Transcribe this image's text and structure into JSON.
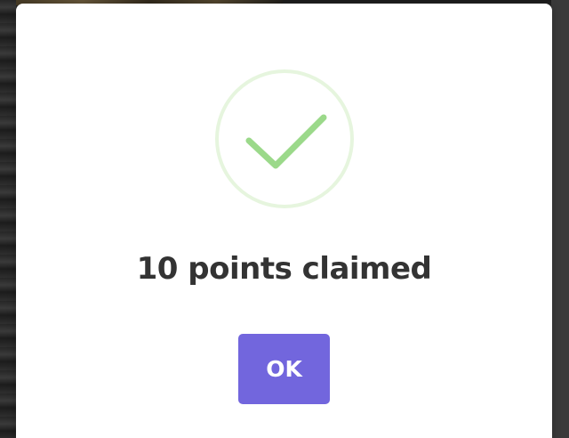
{
  "modal": {
    "icon": "checkmark-icon",
    "title": "10 points claimed",
    "ok_label": "OK"
  },
  "colors": {
    "accent": "#7266dd",
    "success": "#9bd98a",
    "success_ring": "#e6f5de",
    "text": "#333333"
  }
}
